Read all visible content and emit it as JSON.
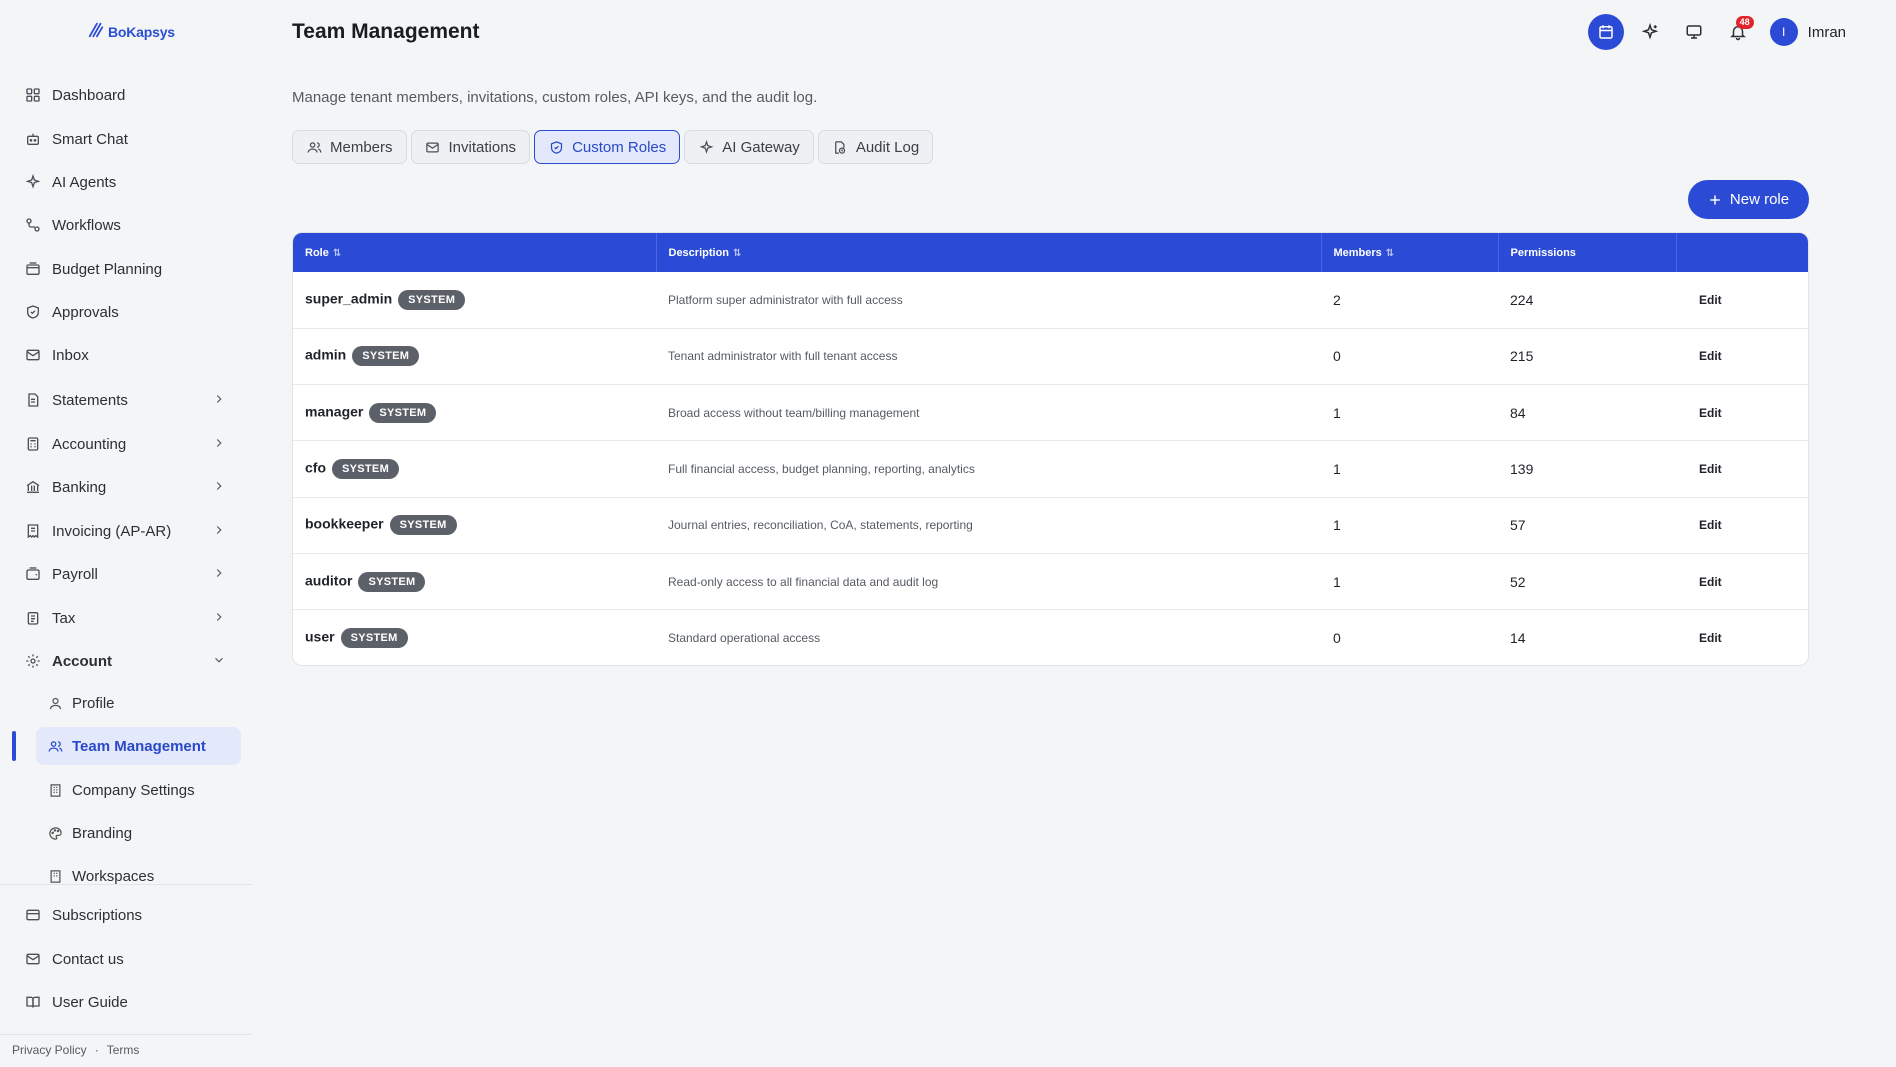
{
  "brand": {
    "name": "BoKapsys",
    "color": "#2b4bd6"
  },
  "sidebar": {
    "items": [
      {
        "label": "Dashboard",
        "icon": "grid-icon"
      },
      {
        "label": "Smart Chat",
        "icon": "bot-icon"
      },
      {
        "label": "AI Agents",
        "icon": "sparkles-icon"
      },
      {
        "label": "Workflows",
        "icon": "workflow-icon"
      },
      {
        "label": "Budget Planning",
        "icon": "wallet-icon"
      },
      {
        "label": "Approvals",
        "icon": "shield-check-icon"
      },
      {
        "label": "Inbox",
        "icon": "mail-icon"
      },
      {
        "label": "Statements",
        "icon": "file-text-icon"
      },
      {
        "label": "Accounting",
        "icon": "calculator-icon"
      },
      {
        "label": "Banking",
        "icon": "bank-icon"
      },
      {
        "label": "Invoicing (AP-AR)",
        "icon": "receipt-icon"
      },
      {
        "label": "Payroll",
        "icon": "wallet-icon"
      },
      {
        "label": "Tax",
        "icon": "clipboard-icon"
      },
      {
        "label": "Account",
        "icon": "gear-icon"
      }
    ],
    "account_sub": [
      {
        "label": "Profile",
        "icon": "user-icon"
      },
      {
        "label": "Team Management",
        "icon": "users-icon"
      },
      {
        "label": "Company Settings",
        "icon": "building-icon"
      },
      {
        "label": "Branding",
        "icon": "palette-icon"
      },
      {
        "label": "Workspaces",
        "icon": "building-icon"
      }
    ],
    "bottom": [
      {
        "label": "Subscriptions",
        "icon": "credit-card-icon"
      },
      {
        "label": "Contact us",
        "icon": "mail-icon"
      },
      {
        "label": "User Guide",
        "icon": "book-icon"
      }
    ],
    "footer": {
      "privacy": "Privacy Policy",
      "sep": "·",
      "terms": "Terms"
    }
  },
  "header": {
    "title": "Team Management",
    "notification_count": "48",
    "user_initial": "I",
    "user_name": "Imran"
  },
  "subtitle": "Manage tenant members, invitations, custom roles, API keys, and the audit log.",
  "tabs": [
    {
      "label": "Members",
      "icon": "users-icon"
    },
    {
      "label": "Invitations",
      "icon": "mail-icon"
    },
    {
      "label": "Custom Roles",
      "icon": "shield-icon",
      "active": true
    },
    {
      "label": "AI Gateway",
      "icon": "sparkles-icon"
    },
    {
      "label": "Audit Log",
      "icon": "file-clock-icon"
    }
  ],
  "new_role_label": "New role",
  "table": {
    "headers": {
      "role": "Role",
      "description": "Description",
      "members": "Members",
      "permissions": "Permissions"
    },
    "rows": [
      {
        "role": "super_admin",
        "badge": "SYSTEM",
        "description": "Platform super administrator with full access",
        "members": "2",
        "permissions": "224",
        "action": "Edit"
      },
      {
        "role": "admin",
        "badge": "SYSTEM",
        "description": "Tenant administrator with full tenant access",
        "members": "0",
        "permissions": "215",
        "action": "Edit"
      },
      {
        "role": "manager",
        "badge": "SYSTEM",
        "description": "Broad access without team/billing management",
        "members": "1",
        "permissions": "84",
        "action": "Edit"
      },
      {
        "role": "cfo",
        "badge": "SYSTEM",
        "description": "Full financial access, budget planning, reporting, analytics",
        "members": "1",
        "permissions": "139",
        "action": "Edit"
      },
      {
        "role": "bookkeeper",
        "badge": "SYSTEM",
        "description": "Journal entries, reconciliation, CoA, statements, reporting",
        "members": "1",
        "permissions": "57",
        "action": "Edit"
      },
      {
        "role": "auditor",
        "badge": "SYSTEM",
        "description": "Read-only access to all financial data and audit log",
        "members": "1",
        "permissions": "52",
        "action": "Edit"
      },
      {
        "role": "user",
        "badge": "SYSTEM",
        "description": "Standard operational access",
        "members": "0",
        "permissions": "14",
        "action": "Edit"
      }
    ]
  }
}
